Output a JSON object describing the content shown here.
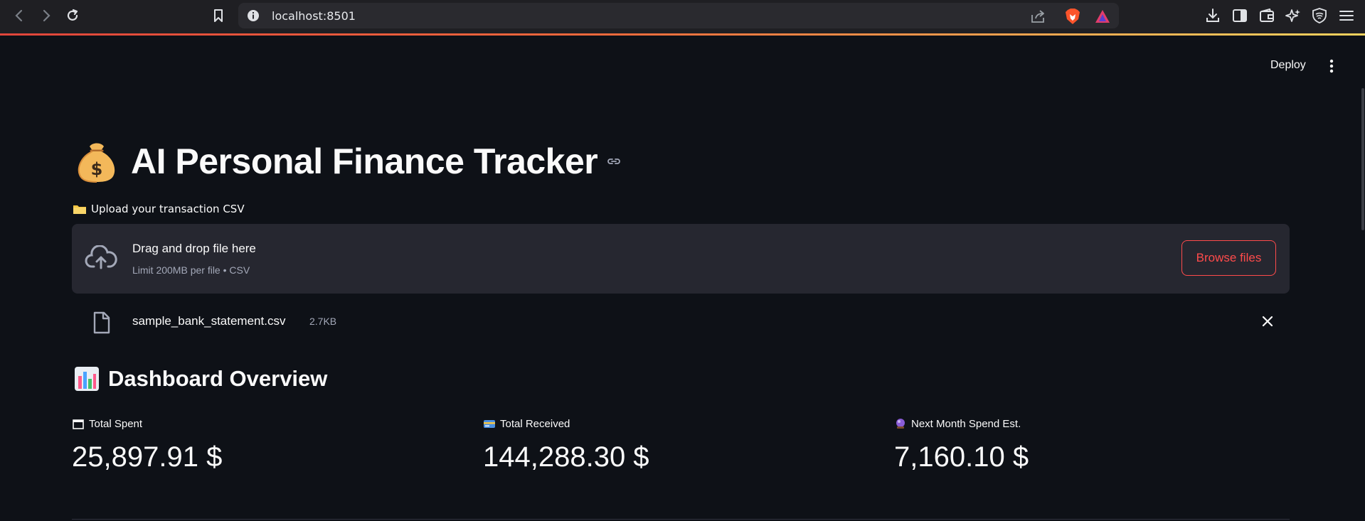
{
  "browser": {
    "url": "localhost:8501"
  },
  "app_header": {
    "deploy_label": "Deploy"
  },
  "page": {
    "title_emoji": "money-bag",
    "title": "AI Personal Finance Tracker"
  },
  "uploader": {
    "label": "Upload your transaction CSV",
    "drop_title": "Drag and drop file here",
    "drop_subtitle": "Limit 200MB per file • CSV",
    "browse_label": "Browse files",
    "file_name": "sample_bank_statement.csv",
    "file_size": "2.7KB"
  },
  "dashboard": {
    "title": "Dashboard Overview",
    "metrics": [
      {
        "label": "Total Spent",
        "value": "25,897.91 $",
        "icon": "calendar-icon"
      },
      {
        "label": "Total Received",
        "value": "144,288.30 $",
        "icon": "credit-card-icon"
      },
      {
        "label": "Next Month Spend Est.",
        "value": "7,160.10 $",
        "icon": "crystal-ball-icon"
      }
    ]
  },
  "colors": {
    "background": "#0e1117",
    "surface": "#262730",
    "primary": "#ff4b4b",
    "muted_text": "#a3a8b8"
  }
}
